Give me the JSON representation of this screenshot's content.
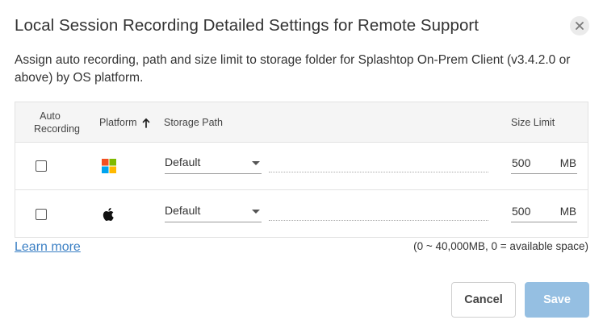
{
  "dialog": {
    "title": "Local Session Recording Detailed Settings for Remote Support",
    "description": "Assign auto recording, path and size limit to storage folder for Splashtop On-Prem Client (v3.4.2.0 or above) by OS platform."
  },
  "table": {
    "headers": {
      "auto_recording": "Auto Recording",
      "platform": "Platform",
      "storage_path": "Storage Path",
      "size_limit": "Size Limit"
    },
    "sort_indicator": "arrow-up-icon",
    "rows": [
      {
        "platform_icon": "windows-icon",
        "auto_recording_checked": false,
        "storage_option": "Default",
        "storage_path": "",
        "size_limit": "500",
        "size_unit": "MB"
      },
      {
        "platform_icon": "apple-icon",
        "auto_recording_checked": false,
        "storage_option": "Default",
        "storage_path": "",
        "size_limit": "500",
        "size_unit": "MB"
      }
    ]
  },
  "footer": {
    "learn_more": "Learn more",
    "hint": "(0 ~ 40,000MB, 0 = available space)"
  },
  "buttons": {
    "cancel": "Cancel",
    "save": "Save"
  },
  "colors": {
    "accent": "#3a7fc4",
    "save_disabled": "#95bfe2",
    "windows_red": "#f25022",
    "windows_green": "#7fba00",
    "windows_blue": "#00a4ef",
    "windows_yellow": "#ffb900"
  }
}
